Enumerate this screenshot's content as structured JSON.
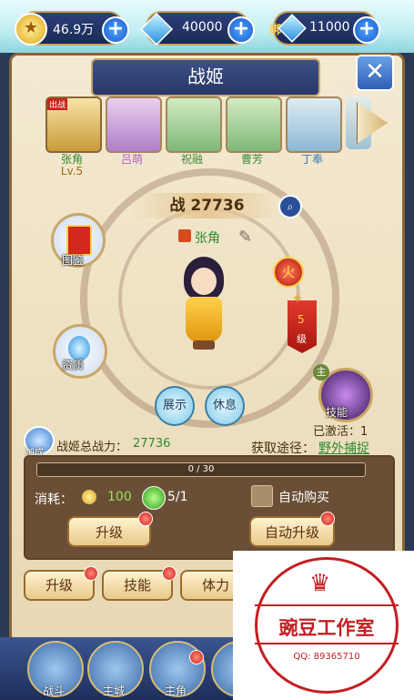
{
  "currency": {
    "gold": "46.9万",
    "diamond": "40000",
    "bound_label": "绑",
    "bound_diamond": "11000",
    "plus": "+"
  },
  "panel": {
    "title": "战姬",
    "close": "✕"
  },
  "heroes": [
    {
      "name": "张角",
      "level": "Lv.5",
      "tag": "出战",
      "color": "#e8c06a"
    },
    {
      "name": "吕萌",
      "color": "#b37ad8"
    },
    {
      "name": "祝融",
      "color": "#6ab86a"
    },
    {
      "name": "曹芳",
      "color": "#6ab86a"
    },
    {
      "name": "丁奉",
      "color": "#7ab5e6"
    }
  ],
  "center": {
    "power_prefix": "战",
    "power": "27736",
    "hero_name": "张角",
    "show_btn": "展示",
    "rest_btn": "休息"
  },
  "side": {
    "codex": "图鉴",
    "aptitude": "资质",
    "fire": "火",
    "star_level": "5",
    "star_unit": "级",
    "skill_tag": "主",
    "skill": "技能",
    "activated": "已激活：1"
  },
  "info": {
    "add": "加成",
    "total_power_label": "战姬总战力：",
    "total_power": "27736",
    "source_label": "获取途径：",
    "source": "野外捕捉"
  },
  "consume": {
    "exp": "0 / 30",
    "exp_fraction": 0,
    "label": "消耗：",
    "gold_cost": "100",
    "item_cost": "5/1",
    "auto_buy": "自动购买",
    "upgrade": "升级",
    "auto_upgrade": "自动升级"
  },
  "tabs": [
    "升级",
    "技能",
    "体力"
  ],
  "nav": [
    "战斗",
    "主城",
    "主角",
    "锻"
  ],
  "watermark": {
    "title": "豌豆工作室",
    "qq": "QQ: 89365710"
  }
}
